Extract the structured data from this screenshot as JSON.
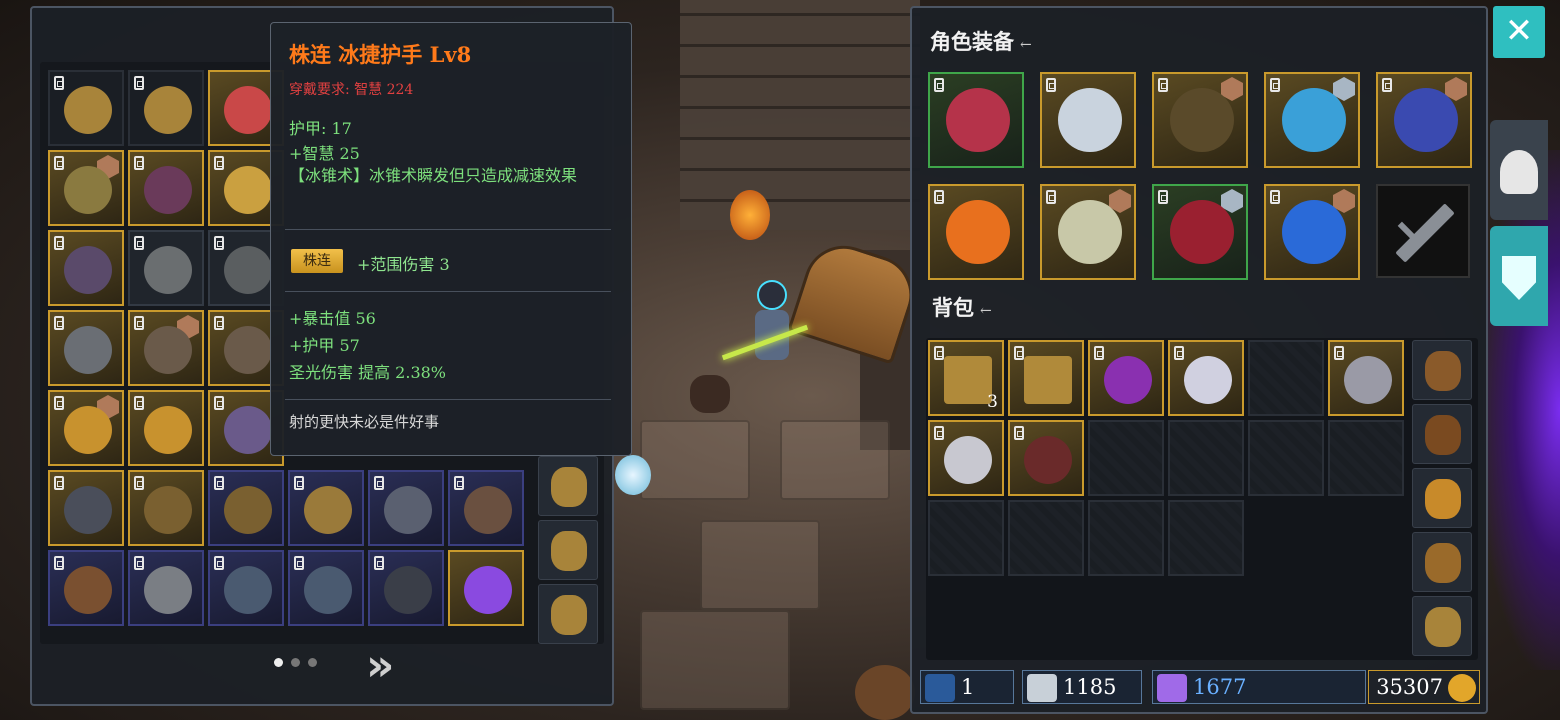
{
  "tooltip": {
    "title": "株连 冰捷护手 Lv8",
    "requirement": "穿戴要求:  智慧 224",
    "armor": "护甲:  17",
    "wisdom": "+智慧 25",
    "effect": "【冰锥术】冰锥术瞬发但只造成减速效果",
    "set_tag": "株连",
    "set_bonus": "+范围伤害 3",
    "crit": "+暴击值 56",
    "armor_bonus": "+护甲 57",
    "holy": "圣光伤害 提高 2.38%",
    "flavor": "射的更快未必是件好事"
  },
  "equipment": {
    "title": "角色装备",
    "title_arrow": "←"
  },
  "backpack": {
    "title": "背包",
    "title_arrow": "←",
    "stack_count": "3"
  },
  "resources": {
    "scrolls": "1",
    "hearts": "1185",
    "gems": "1677",
    "gold": "35307"
  },
  "pager": {
    "next": "»"
  },
  "close_label": "✕",
  "colors": {
    "accent": "#2fbfc0",
    "legendary_title": "#ff7a1a",
    "requirement_red": "#e04040",
    "stat_green": "#7de07d",
    "gold_border": "#c99a2c",
    "green_border": "#3fa64a"
  }
}
